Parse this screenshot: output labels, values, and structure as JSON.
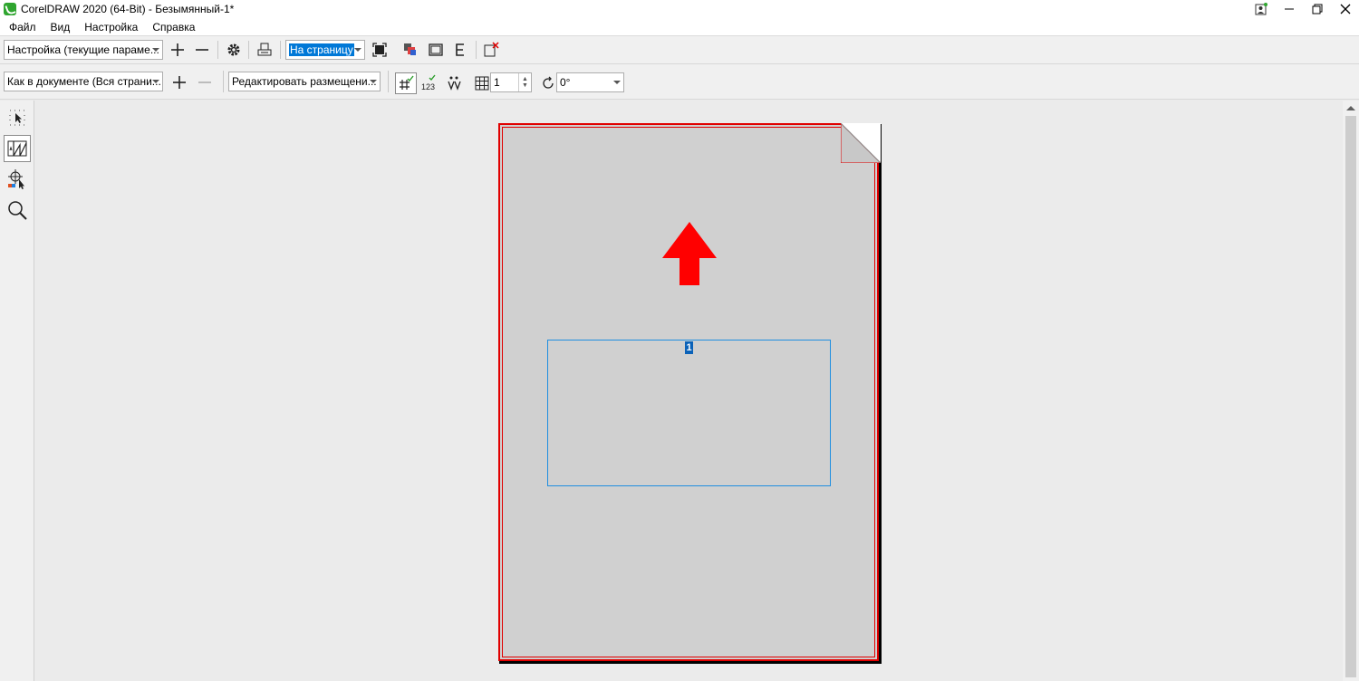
{
  "window": {
    "title": "CorelDRAW 2020 (64-Bit) - Безымянный-1*",
    "controls": [
      "person-icon",
      "minimize",
      "restore",
      "close"
    ]
  },
  "menu": [
    {
      "label": "Файл"
    },
    {
      "label": "Вид"
    },
    {
      "label": "Настройка"
    },
    {
      "label": "Справка"
    }
  ],
  "toolbar1": {
    "preset_value": "Настройка (текущие параме...",
    "zoom_value": "На страницу"
  },
  "toolbar2": {
    "pages_value": "Как в документе (Вся страни...",
    "layout_value": "Редактировать размещени...",
    "copies_value": "1",
    "rotation_value": "0°",
    "number_label": "123"
  },
  "page": {
    "frame_number": "1"
  },
  "colors": {
    "accent": "#0078d7",
    "page_border": "#e00000",
    "frame_border": "#1f8ee0",
    "arrow": "#ff0000"
  }
}
